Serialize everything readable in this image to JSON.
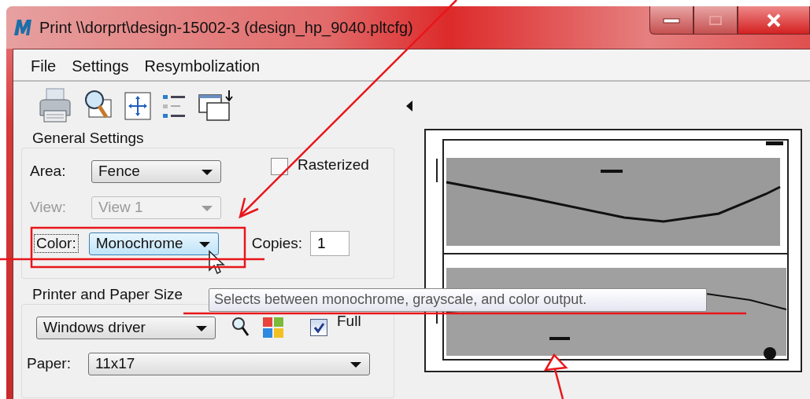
{
  "window": {
    "title": "Print  \\\\dorprt\\design-15002-3  (design_hp_9040.pltcfg)"
  },
  "menu": [
    {
      "label": "File"
    },
    {
      "label": "Settings"
    },
    {
      "label": "Resymbolization"
    }
  ],
  "general_settings": {
    "title": "General Settings",
    "area": {
      "label": "Area:",
      "value": "Fence",
      "disabled": false
    },
    "view": {
      "label": "View:",
      "value": "View 1",
      "disabled": true
    },
    "color": {
      "label": "Color:",
      "value": "Monochrome",
      "focused": true
    },
    "rasterized": {
      "label": "Rasterized",
      "checked": false
    },
    "copies": {
      "label": "Copies:",
      "value": "1"
    }
  },
  "printer_and_paper": {
    "title": "Printer and Paper Size",
    "driver": "Windows driver",
    "full": {
      "label": "Full",
      "checked": true
    },
    "paper": {
      "label": "Paper:",
      "value": "11x17"
    }
  },
  "tooltip": "Selects between monochrome, grayscale, and color output."
}
